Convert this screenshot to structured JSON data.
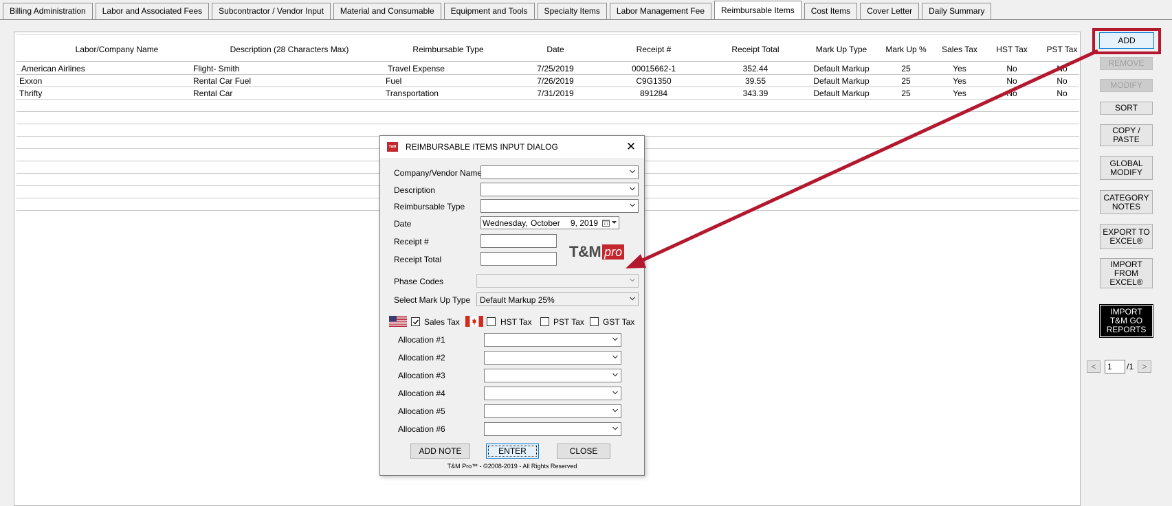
{
  "tabs": [
    {
      "label": "Billing Administration"
    },
    {
      "label": "Labor and Associated Fees"
    },
    {
      "label": "Subcontractor / Vendor Input"
    },
    {
      "label": "Material and Consumable"
    },
    {
      "label": "Equipment and Tools"
    },
    {
      "label": "Specialty Items"
    },
    {
      "label": "Labor Management Fee"
    },
    {
      "label": "Reimbursable Items"
    },
    {
      "label": "Cost Items"
    },
    {
      "label": "Cover Letter"
    },
    {
      "label": "Daily Summary"
    }
  ],
  "active_tab": "Reimbursable Items",
  "table": {
    "headers": [
      "Labor/Company Name",
      "Description (28 Characters Max)",
      "Reimbursable Type",
      "Date",
      "Receipt #",
      "Receipt Total",
      "Mark Up Type",
      "Mark Up %",
      "Sales Tax",
      "HST Tax",
      "PST Tax"
    ],
    "rows": [
      [
        "American Airlines",
        "Flight- Smith",
        "Travel Expense",
        "7/25/2019",
        "00015662-1",
        "352.44",
        "Default Markup",
        "25",
        "Yes",
        "No",
        "No"
      ],
      [
        "Exxon",
        "Rental Car Fuel",
        "Fuel",
        "7/26/2019",
        "C9G1350",
        "39.55",
        "Default Markup",
        "25",
        "Yes",
        "No",
        "No"
      ],
      [
        "Thrifty",
        "Rental Car",
        "Transportation",
        "7/31/2019",
        "891284",
        "343.39",
        "Default Markup",
        "25",
        "Yes",
        "No",
        "No"
      ]
    ]
  },
  "side_buttons": {
    "add": "ADD",
    "remove": "REMOVE",
    "modify": "MODIFY",
    "sort": "SORT",
    "copy_paste": "COPY /\nPASTE",
    "global_modify": "GLOBAL\nMODIFY",
    "category_notes": "CATEGORY\nNOTES",
    "export_excel": "EXPORT TO\nEXCEL®",
    "import_excel": "IMPORT\nFROM\nEXCEL®",
    "import_tm_go": "IMPORT\nT&M GO\nREPORTS"
  },
  "pager": {
    "prev": "<",
    "page": "1",
    "total": "/1",
    "next": ">"
  },
  "dialog": {
    "logo_text": "T&M",
    "title": "REIMBURSABLE ITEMS INPUT DIALOG",
    "close": "✕",
    "labels": {
      "company": "Company/Vendor Name",
      "description": "Description",
      "reimbursable_type": "Reimbursable Type",
      "date": "Date",
      "receipt_no": "Receipt #",
      "receipt_total": "Receipt Total",
      "phase_codes": "Phase Codes",
      "markup_type": "Select Mark Up Type"
    },
    "values": {
      "company": "",
      "description": "",
      "reimbursable_type": "",
      "date_weekday": "Wednesday,",
      "date_month": "October",
      "date_day": "9, 2019",
      "receipt_no": "",
      "receipt_total": "",
      "phase_codes": "",
      "markup_type": "Default Markup 25%"
    },
    "brand": {
      "tm": "T&M",
      "pro": "pro"
    },
    "taxes": {
      "sales": {
        "label": "Sales Tax",
        "checked": true
      },
      "hst": {
        "label": "HST Tax",
        "checked": false
      },
      "pst": {
        "label": "PST Tax",
        "checked": false
      },
      "gst": {
        "label": "GST Tax",
        "checked": false
      }
    },
    "allocations": [
      "Allocation #1",
      "Allocation #2",
      "Allocation #3",
      "Allocation #4",
      "Allocation #5",
      "Allocation #6"
    ],
    "buttons": {
      "add_note": "ADD NOTE",
      "enter": "ENTER",
      "close": "CLOSE"
    },
    "copyright": "T&M Pro™ - ©2008-2019 - All Rights Reserved"
  },
  "colors": {
    "accent_red": "#b3182e",
    "brand_red": "#c4282e",
    "focus_blue": "#0078d7"
  },
  "icons": [
    "us-flag-icon",
    "canada-flag-icon",
    "calendar-icon",
    "chevron-down-icon",
    "close-icon",
    "arrow-annotation"
  ]
}
